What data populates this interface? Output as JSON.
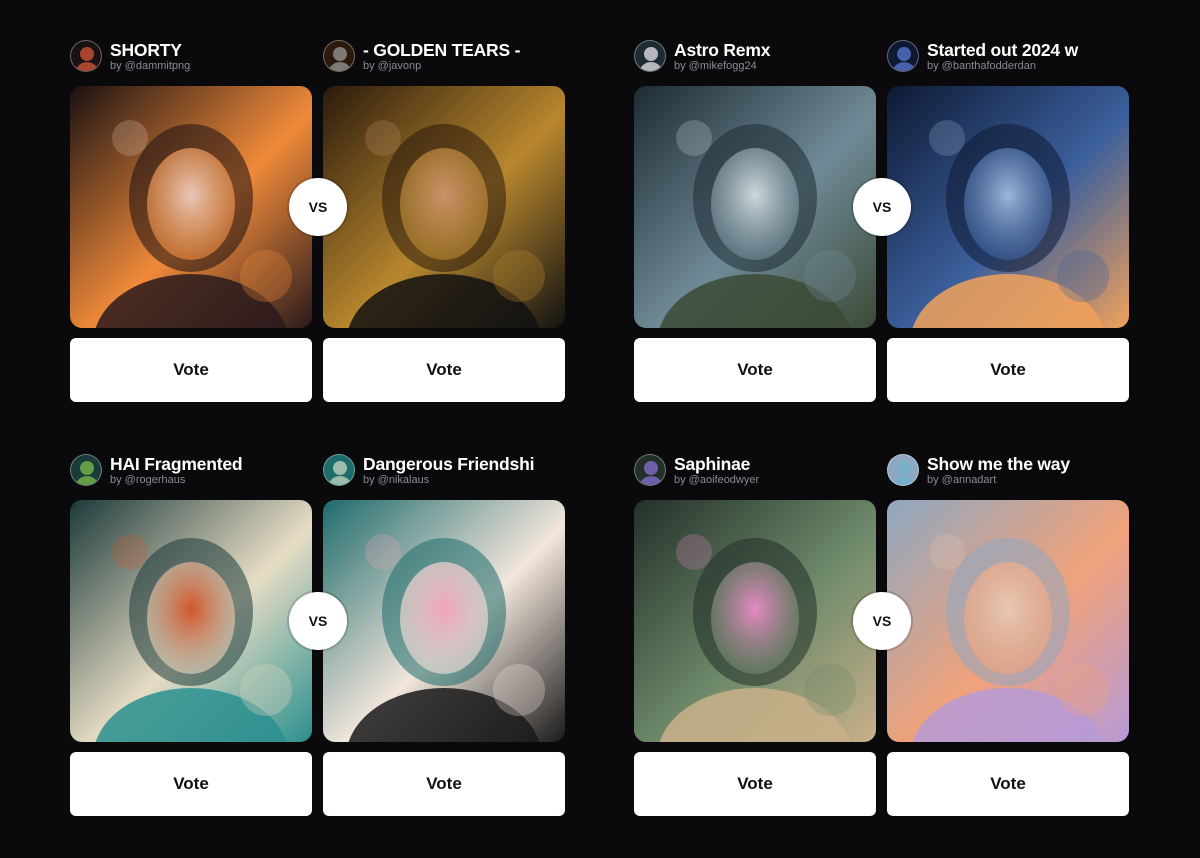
{
  "vs_label": "VS",
  "vote_label": "Vote",
  "matchups": [
    {
      "left": {
        "title": "SHORTY",
        "author": "by @dammitpng",
        "avatar_color": "#d9573a",
        "palette": [
          "#1a1112",
          "#f08a3a",
          "#e8c7b8",
          "#2a1a1c"
        ],
        "artwork_icon": "portrait-fire-artwork"
      },
      "right": {
        "title": "- GOLDEN TEARS -",
        "author": "by @javonp",
        "avatar_color": "#9a9a9a",
        "palette": [
          "#2a1a0c",
          "#b8872e",
          "#c9926a",
          "#121212"
        ],
        "artwork_icon": "portrait-golden-halo-artwork"
      }
    },
    {
      "left": {
        "title": "Astro Remx",
        "author": "by @mikefogg24",
        "avatar_color": "#e8e8e8",
        "palette": [
          "#1d2b33",
          "#6f8a96",
          "#cfd8dc",
          "#3c4a36"
        ],
        "artwork_icon": "astronaut-subway-artwork"
      },
      "right": {
        "title": "Started out 2024  w",
        "author": "by @banthafodderdan",
        "avatar_color": "#5b7bd6",
        "palette": [
          "#0e1a33",
          "#3b5f9c",
          "#9fb6d9",
          "#f0a15c"
        ],
        "artwork_icon": "night-city-artwork"
      }
    },
    {
      "left": {
        "title": "HAI Fragmented",
        "author": "by @rogerhaus",
        "avatar_color": "#7ac04a",
        "palette": [
          "#1b3a3a",
          "#e6dcc4",
          "#d2552a",
          "#2a8f8f"
        ],
        "artwork_icon": "fragmented-portrait-artwork"
      },
      "right": {
        "title": "Dangerous Friendshi",
        "author": "by @nikalaus",
        "avatar_color": "#c9d6c0",
        "palette": [
          "#1d6b6b",
          "#f2e6dc",
          "#f1a6b8",
          "#1a1a1a"
        ],
        "artwork_icon": "girl-crocodile-artwork"
      }
    },
    {
      "left": {
        "title": "Saphinae",
        "author": "by @aoifeodwyer",
        "avatar_color": "#8a6fd0",
        "palette": [
          "#23302a",
          "#6e8a6a",
          "#e58ac4",
          "#c9b08a"
        ],
        "artwork_icon": "jungle-woman-artwork"
      },
      "right": {
        "title": "Show me the way",
        "author": "by @annadart",
        "avatar_color": "#6fb3c9",
        "palette": [
          "#8fa8c2",
          "#f0a27a",
          "#e7c8b4",
          "#b69ad6"
        ],
        "artwork_icon": "skeleton-lovers-artwork"
      }
    }
  ]
}
